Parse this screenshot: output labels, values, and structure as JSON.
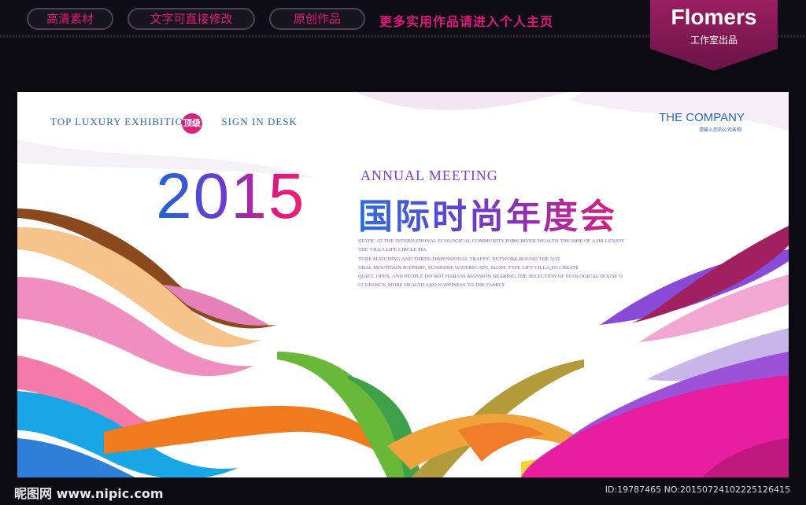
{
  "topbar": {
    "pills": [
      "高清素材",
      "文字可直接修改",
      "原创作品"
    ],
    "promo": "更多实用作品请进入个人主页"
  },
  "badge": {
    "brand": "Flomers",
    "subtitle": "工作室出品"
  },
  "poster": {
    "tagline_left": "TOP LUXURY EXHIBITION",
    "tagline_badge": "顶级",
    "tagline_right": "SIGN IN DESK",
    "company_name": "THE COMPANY",
    "company_sub": "请输入您的公司名称",
    "year": "2015",
    "annual_meeting": "ANNUAL MEETING",
    "title_cn": "国际时尚年度会",
    "body_lines": [
      "STATIC AT THE INTERNATIONAL ECOLOGICAL COMMUNITY PARK RIVER WEALTH THE SIDE OF A HILLENJOY",
      "THE VILLA LIFE CIRCLE MA",
      "TURE MATCHING AND THREE-DIMENSIONAL TRAFFIC NETWORK,ROUND THE NAT",
      "URAL MOUNTAIN SCENERY, SUNSHINE WATERSCAPE, SLOPE TYPE LIFT VILLA,TO CREATE",
      "QUIET, OPEN, AND PEOPLE DO NOT HARASS MANSION BEARING,THE SELECTION OF ECOLOGICAL HOUSE O",
      "CCUPANCY, MORE HEALTH AND HAPPINESS TO THE FAMILY."
    ]
  },
  "watermark": {
    "site": "昵图网 www.nipic.com",
    "id_text": "ID:19787465 NO:20150724102225126415"
  },
  "colors": {
    "accent_pink": "#e0177e",
    "blue": "#2a66b8",
    "purple": "#7c3fd0"
  }
}
